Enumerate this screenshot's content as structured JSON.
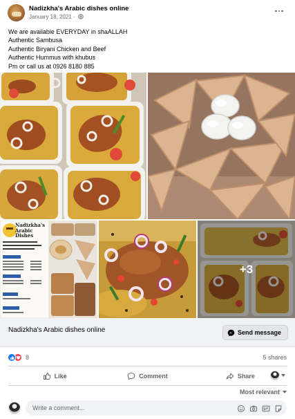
{
  "post": {
    "page_name": "Nadizkha's Arabic dishes online",
    "timestamp": "January 18, 2021 · ",
    "text_lines": [
      "We are available EVERYDAY in shaALLAH",
      "Authentic Sambusa",
      "Authentic Biryani Chicken and Beef",
      "Authentic Hummus with khubus",
      "Pm or call us at 0926 8180 885"
    ]
  },
  "photos": {
    "more_count": "+3",
    "menu_card": {
      "title_line1": "Nadizkha's",
      "title_line2": "Arabic",
      "title_line3": "Dishes"
    }
  },
  "link_card": {
    "title": "Nadizkha's Arabic dishes online",
    "button_label": "Send message"
  },
  "reactions": {
    "count": "8",
    "shares": "5 shares"
  },
  "actions": {
    "like": "Like",
    "comment": "Comment",
    "share": "Share"
  },
  "comments": {
    "sort_label": "Most relevant",
    "placeholder": "Write a comment..."
  },
  "colors": {
    "like_blue": "#1877f2",
    "love_red": "#f33e58",
    "secondary_text": "#65676b",
    "card_bg": "#f0f2f5"
  }
}
